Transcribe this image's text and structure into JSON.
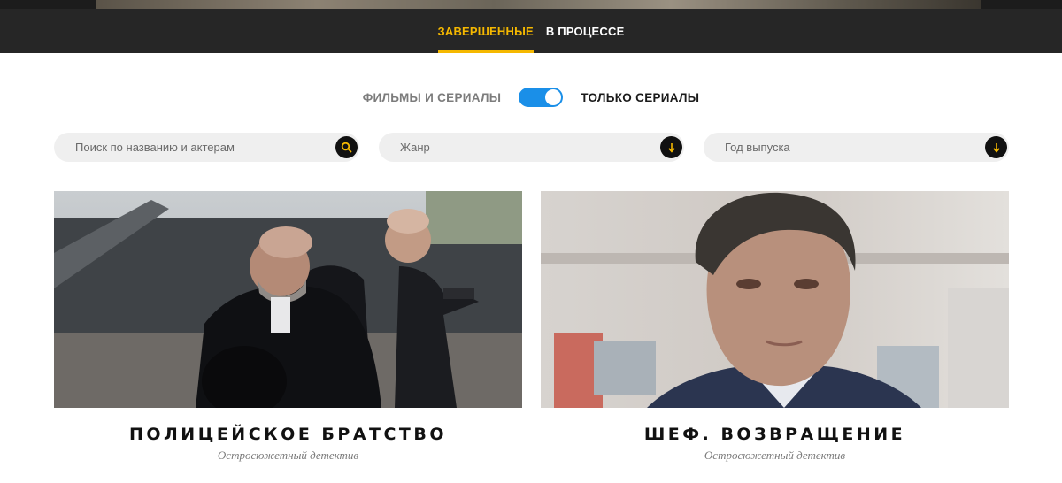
{
  "tabs": [
    {
      "label": "ЗАВЕРШЕННЫЕ",
      "active": true
    },
    {
      "label": "В ПРОЦЕССЕ",
      "active": false
    }
  ],
  "toggle": {
    "left_label": "ФИЛЬМЫ И СЕРИАЛЫ",
    "right_label": "ТОЛЬКО СЕРИАЛЫ",
    "state": "on"
  },
  "filters": {
    "search": {
      "placeholder": "Поиск по названию и актерам",
      "icon": "search-icon"
    },
    "genre": {
      "label": "Жанр",
      "icon": "arrow-down-icon"
    },
    "year": {
      "label": "Год выпуска",
      "icon": "arrow-down-icon"
    }
  },
  "cards": [
    {
      "title": "ПОЛИЦЕЙСКОЕ БРАТСТВО",
      "genre": "Остросюжетный детектив"
    },
    {
      "title": "ШЕФ. ВОЗВРАЩЕНИЕ",
      "genre": "Остросюжетный детектив"
    }
  ],
  "colors": {
    "accent": "#f5b800",
    "dark_bar": "#262626",
    "toggle_blue": "#1a8fe8",
    "field_bg": "#efefef"
  }
}
